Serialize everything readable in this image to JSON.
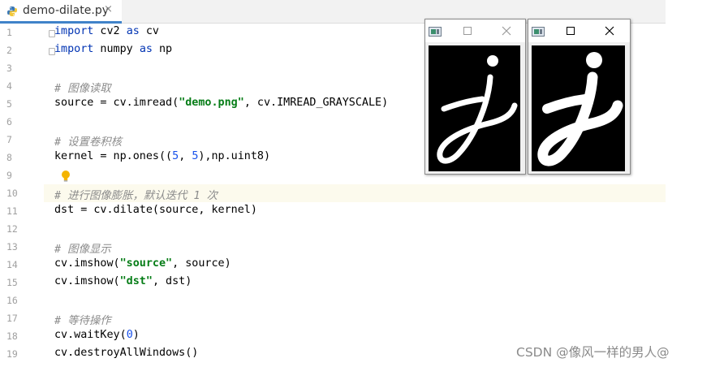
{
  "tab": {
    "filename": "demo-dilate.py",
    "close_glyph": "×"
  },
  "editor": {
    "highlighted_line": 10,
    "lines": [
      {
        "n": "1",
        "code": "import cv2 as cv"
      },
      {
        "n": "2",
        "code": "import numpy as np"
      },
      {
        "n": "3",
        "code": ""
      },
      {
        "n": "4",
        "code": "# 图像读取"
      },
      {
        "n": "5",
        "code": "source = cv.imread(\"demo.png\", cv.IMREAD_GRAYSCALE)"
      },
      {
        "n": "6",
        "code": ""
      },
      {
        "n": "7",
        "code": "# 设置卷积核"
      },
      {
        "n": "8",
        "code": "kernel = np.ones((5, 5),np.uint8)"
      },
      {
        "n": "9",
        "code": ""
      },
      {
        "n": "10",
        "code": "# 进行图像膨胀，默认迭代 1 次"
      },
      {
        "n": "11",
        "code": "dst = cv.dilate(source, kernel)"
      },
      {
        "n": "12",
        "code": ""
      },
      {
        "n": "13",
        "code": "# 图像显示"
      },
      {
        "n": "14",
        "code": "cv.imshow(\"source\", source)"
      },
      {
        "n": "15",
        "code": "cv.imshow(\"dst\", dst)"
      },
      {
        "n": "16",
        "code": ""
      },
      {
        "n": "17",
        "code": "# 等待操作"
      },
      {
        "n": "18",
        "code": "cv.waitKey(0)"
      },
      {
        "n": "19",
        "code": "cv.destroyAllWindows()"
      }
    ]
  },
  "windows": [
    {
      "id": "source",
      "image": "letter-j-thin"
    },
    {
      "id": "dst",
      "image": "letter-j-dilated"
    }
  ],
  "colors": {
    "keyword": "#0033b3",
    "string": "#067d17",
    "number": "#1750eb",
    "comment": "#8c8c8c",
    "line_highlight": "#fcfaed",
    "tab_accent": "#4083c9"
  },
  "watermark": "CSDN @像风一样的男人@"
}
